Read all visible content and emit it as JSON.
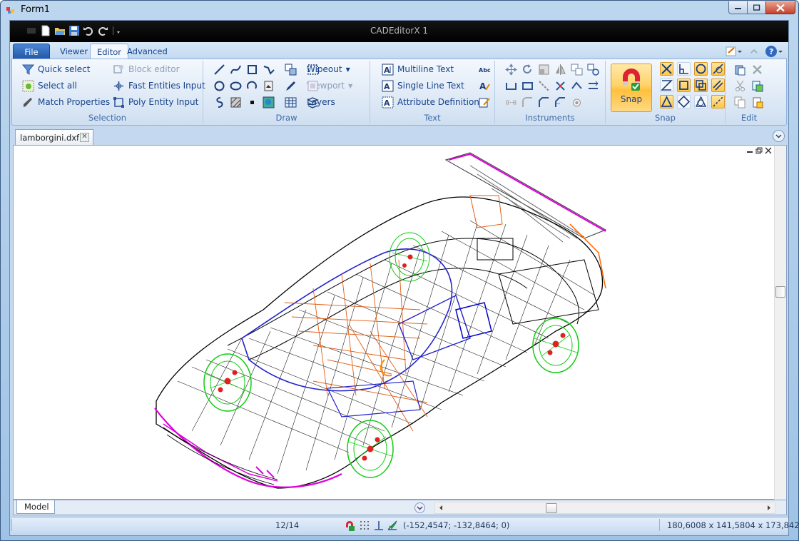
{
  "window": {
    "title": "Form1"
  },
  "app": {
    "title": "CADEditorX 1"
  },
  "tabs": [
    {
      "label": "File"
    },
    {
      "label": "Viewer"
    },
    {
      "label": "Editor"
    },
    {
      "label": "Advanced"
    }
  ],
  "ribbon": {
    "selection": {
      "label": "Selection",
      "items": [
        "Quick select",
        "Select all",
        "Match Properties",
        "Block editor",
        "Fast Entities Input",
        "Poly Entity Input"
      ]
    },
    "draw": {
      "label": "Draw",
      "items": [
        "Wipeout",
        "Viewport",
        "Layers"
      ]
    },
    "text": {
      "label": "Text",
      "items": [
        "Multiline Text",
        "Single Line Text",
        "Attribute Definition"
      ]
    },
    "instruments": {
      "label": "Instruments"
    },
    "snap": {
      "label": "Snap",
      "button": "Snap"
    },
    "edit": {
      "label": "Edit"
    }
  },
  "document": {
    "tab": "lamborgini.dxf",
    "layout_tab": "Model"
  },
  "status": {
    "page": "12/14",
    "coords": "(-152,4547; -132,8464; 0)",
    "extents": "180,6008 x 141,5804 x 173,8424"
  },
  "colors": {
    "ribbon_blue": "#15428b",
    "file_tab": "#2f6ac0",
    "snap_active": "#ffc64a"
  }
}
